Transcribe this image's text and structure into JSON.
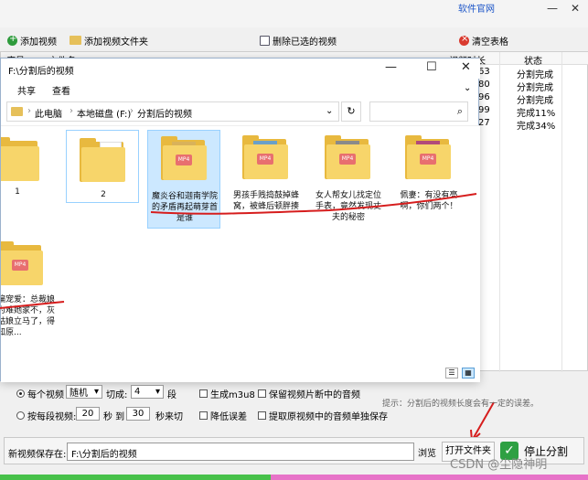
{
  "topbar": {
    "official_link": "软件官网",
    "min": "—",
    "close": "✕"
  },
  "toolbar": {
    "add_video": "添加视频",
    "add_folder": "添加视频文件夹",
    "delete_selected": "删除已选的视频",
    "clear_table": "清空表格"
  },
  "table": {
    "headers": [
      "序号",
      "文件名",
      "视频时长",
      "状态"
    ],
    "rows": [
      {
        "duration": "63",
        "status": "分割完成"
      },
      {
        "duration": "80",
        "status": "分割完成"
      },
      {
        "duration": "96",
        "status": "分割完成"
      },
      {
        "duration": "99",
        "status": "完成11%"
      },
      {
        "duration": "27",
        "status": "完成34%"
      }
    ]
  },
  "explorer": {
    "title_path": "F:\\分割后的视频",
    "menu": [
      "共享",
      "查看"
    ],
    "breadcrumb": [
      "此电脑",
      "本地磁盘 (F:)",
      "分割后的视频"
    ],
    "items": [
      {
        "label": "1"
      },
      {
        "label": "2"
      },
      {
        "label": "魔炎谷和迦南学院的矛盾再起萌芽首是谁"
      },
      {
        "label": "男孩手贱捣鼓掉蜂窝，被蜂后顿胖揍"
      },
      {
        "label": "女人帮女儿找定位手表，竟然发现丈夫的秘密"
      },
      {
        "label": "佩妻：有没有亮啊，你们两个！"
      },
      {
        "label": "偏宠爱：总裁娘为难她家不，灰姑娘立马了，得知原..."
      }
    ]
  },
  "options": {
    "per_video": "每个视频",
    "random": "随机",
    "cut_into": "切成:",
    "count": "4",
    "segments": "段",
    "gen_m3u8": "生成m3u8",
    "keep_audio": "保留视频片断中的音频",
    "by_seconds": "按每段视频:",
    "sec_from": "20",
    "sec_to_label": "秒 到",
    "sec_to": "30",
    "sec_cut": "秒来切",
    "lower_error": "降低误差",
    "extract_audio": "提取原视频中的音频单独保存",
    "hint": "提示：分割后的视频长度会有一定的误差。"
  },
  "save": {
    "label": "新视频保存在:",
    "path": "F:\\分割后的视频",
    "browse": "浏览",
    "open_folder": "打开文件夹",
    "stop": "停止分割"
  },
  "watermark": "CSDN @尘隐神明",
  "progress": {
    "completed_fraction": 0.46
  }
}
